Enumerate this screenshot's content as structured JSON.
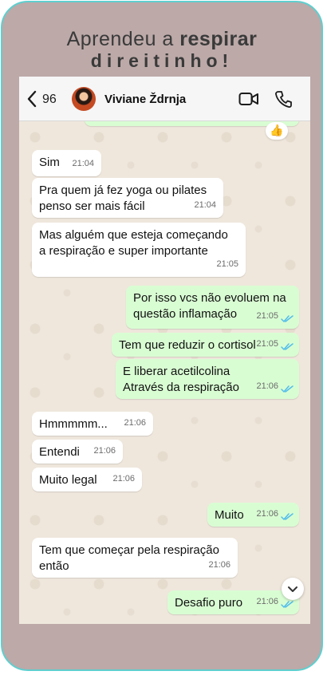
{
  "headline": {
    "line1_regular": "Aprendeu a",
    "line1_bold": "respirar",
    "line2": "direitinho!"
  },
  "chat_header": {
    "back_count": "96",
    "contact_name": "Viviane Ždrnja"
  },
  "reaction_emoji": "👍",
  "messages": [
    {
      "dir": "in",
      "lines": [
        "Sim"
      ],
      "time": "21:04"
    },
    {
      "dir": "in",
      "lines": [
        "Pra quem já fez yoga ou pilates",
        "penso ser mais fácil"
      ],
      "time": "21:04"
    },
    {
      "dir": "in",
      "lines": [
        "Mas alguém que esteja começando",
        "a respiração e super importante"
      ],
      "time": "21:05"
    },
    {
      "dir": "out",
      "lines": [
        "Por isso vcs não evoluem na",
        "questão inflamação"
      ],
      "time": "21:05"
    },
    {
      "dir": "out",
      "lines": [
        "Tem que reduzir o cortisol"
      ],
      "time": "21:05"
    },
    {
      "dir": "out",
      "lines": [
        "E liberar acetilcolina",
        "Através da respiração"
      ],
      "time": "21:06"
    },
    {
      "dir": "in",
      "lines": [
        "Hmmmmm..."
      ],
      "time": "21:06"
    },
    {
      "dir": "in",
      "lines": [
        "Entendi"
      ],
      "time": "21:06"
    },
    {
      "dir": "in",
      "lines": [
        "Muito legal"
      ],
      "time": "21:06"
    },
    {
      "dir": "out",
      "lines": [
        "Muito"
      ],
      "time": "21:06"
    },
    {
      "dir": "in",
      "lines": [
        "Tem que começar pela respiração",
        "então"
      ],
      "time": "21:06"
    },
    {
      "dir": "out",
      "lines": [
        "Desafio puro"
      ],
      "time": "21:06"
    }
  ],
  "colors": {
    "frame_border": "#5fcfcf",
    "frame_bg": "#bca9a8",
    "outgoing_bubble": "#d9fdd3",
    "incoming_bubble": "#ffffff",
    "read_ticks": "#53bdeb"
  }
}
